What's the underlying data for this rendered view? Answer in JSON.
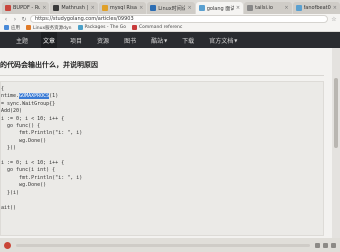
{
  "browser": {
    "tabs": [
      {
        "label": "BUPDF - Rusti",
        "color": "#c9463d",
        "active": false
      },
      {
        "label": "Mathrush | Lu",
        "color": "#3a3a3a",
        "active": false
      },
      {
        "label": "mysql Risa",
        "color": "#e0a028",
        "active": false
      },
      {
        "label": "Linux时间设置",
        "color": "#2c6db3",
        "active": false
      },
      {
        "label": "golang 面试题",
        "color": "#5aa0d0",
        "active": true
      },
      {
        "label": "tailsi.io",
        "color": "#888888",
        "active": false
      },
      {
        "label": "fanofbeat00",
        "color": "#5aa0d0",
        "active": false
      }
    ],
    "url": "https://studygolang.com/articles/09903",
    "bookmarks": [
      {
        "label": "应用",
        "color": "#4a8ad8"
      },
      {
        "label": "Linux服务资源dyn",
        "color": "#e07a28"
      },
      {
        "label": "Packages - The Go",
        "color": "#4aa0c8"
      },
      {
        "label": "Command referenc",
        "color": "#c83a3a"
      }
    ]
  },
  "site_nav": {
    "items": [
      {
        "label": "主题",
        "active": false,
        "dropdown": false
      },
      {
        "label": "文章",
        "active": true,
        "dropdown": false
      },
      {
        "label": "项目",
        "active": false,
        "dropdown": false
      },
      {
        "label": "资源",
        "active": false,
        "dropdown": false
      },
      {
        "label": "图书",
        "active": false,
        "dropdown": false
      },
      {
        "label": "酷站",
        "active": false,
        "dropdown": true
      },
      {
        "label": "下载",
        "active": false,
        "dropdown": false
      },
      {
        "label": "官方文档",
        "active": false,
        "dropdown": true
      }
    ]
  },
  "article": {
    "heading": "的代码会输出什么，并说明原因",
    "code_lines": [
      "{",
      "ntime.",
      "= sync.WaitGroup{}",
      "Add(20)",
      "i := 0; i < 10; i++ {",
      "  go func() {",
      "      fmt.Println(\"i: \", i)",
      "      wg.Done()",
      "  }()",
      "",
      "i := 0; i < 10; i++ {",
      "  go func(i int) {",
      "      fmt.Println(\"i: \", i)",
      "      wg.Done()",
      "  }(i)",
      "",
      "ait()"
    ],
    "highlight": {
      "prefix": "ntime.",
      "text": "GOMAXPROCS",
      "suffix": "(1)"
    }
  },
  "colors": {
    "nav_bg": "#2a2c30",
    "highlight": "#3b7bd4",
    "page_bg": "#f3f2f0"
  }
}
